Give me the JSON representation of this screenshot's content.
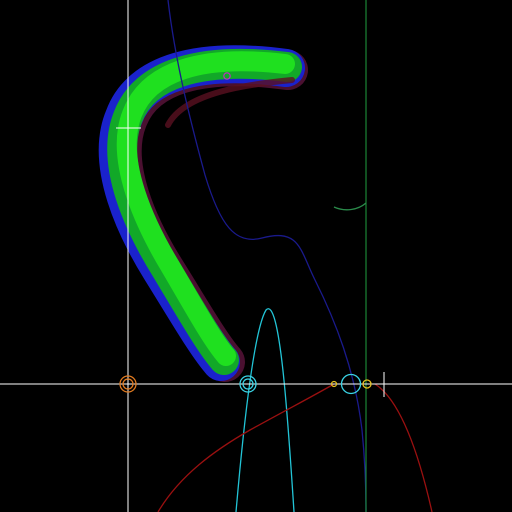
{
  "colors": {
    "background": "#000000",
    "axis": "#ffffff",
    "curve_navy": "#1a1a8c",
    "curve_cyan": "#22c4d6",
    "curve_red": "#9a1010",
    "vertical_line": "#1f9f3f",
    "small_arc": "#2a8a4a",
    "shape_green": "#16d616",
    "shape_blue": "#1a22cc",
    "shape_red": "#6a1020",
    "marker_orange": "#e07a20",
    "marker_cyan": "#3ad4e6",
    "marker_yellow": "#e6c020",
    "marker_magenta": "#c030c0"
  },
  "icons": {
    "axis_markers": [
      "orange-ring-marker",
      "cyan-double-ring-marker",
      "yellow-dot-marker",
      "cyan-ring-marker",
      "yellow-ring-marker"
    ],
    "shape_marker": "magenta-ring-marker",
    "crosshair": "crosshair-tick"
  }
}
